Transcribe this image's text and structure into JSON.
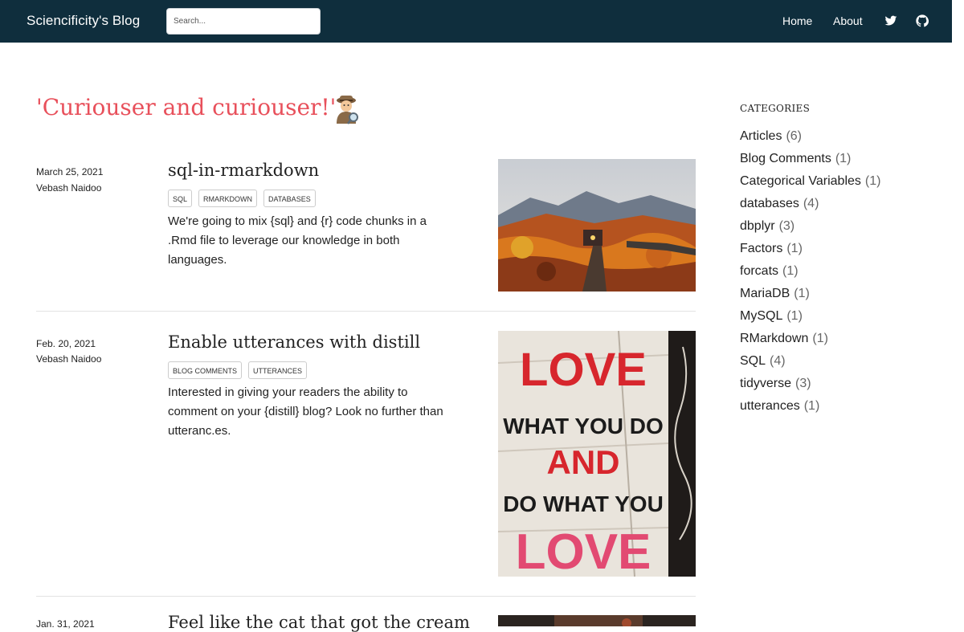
{
  "navbar": {
    "brand": "Sciencificity's Blog",
    "search_placeholder": "Search...",
    "links": [
      "Home",
      "About"
    ],
    "icons": [
      "twitter-icon",
      "github-icon"
    ],
    "background": "#0f2e3d"
  },
  "page": {
    "title": "'Curiouser and curiouser!'",
    "title_icon": "detective-icon",
    "title_color": "#e8505b"
  },
  "posts": [
    {
      "date": "March 25, 2021",
      "author": "Vebash Naidoo",
      "title": "sql-in-rmarkdown",
      "tags": [
        "SQL",
        "RMARKDOWN",
        "DATABASES"
      ],
      "description": "We're going to mix {sql} and {r} code chunks in a .Rmd file to leverage our knowledge in both languages.",
      "image": "autumn-train-image"
    },
    {
      "date": "Feb. 20, 2021",
      "author": "Vebash Naidoo",
      "title": "Enable utterances with distill",
      "tags": [
        "BLOG COMMENTS",
        "UTTERANCES"
      ],
      "description": "Interested in giving your readers the ability to comment on your {distill} blog? Look no further than utteranc.es.",
      "image": "love-sign-image",
      "image_text": [
        "LOVE",
        "WHAT YOU DO",
        "AND",
        "DO WHAT YOU",
        "LOVE"
      ]
    },
    {
      "date": "Jan. 31, 2021",
      "title": "Feel like the cat that got the cream",
      "image": "third-post-image"
    }
  ],
  "sidebar": {
    "heading": "CATEGORIES",
    "categories": [
      {
        "name": "Articles",
        "count": "(6)"
      },
      {
        "name": "Blog Comments",
        "count": "(1)"
      },
      {
        "name": "Categorical Variables",
        "count": "(1)"
      },
      {
        "name": "databases",
        "count": "(4)"
      },
      {
        "name": "dbplyr",
        "count": "(3)"
      },
      {
        "name": "Factors",
        "count": "(1)"
      },
      {
        "name": "forcats",
        "count": "(1)"
      },
      {
        "name": "MariaDB",
        "count": "(1)"
      },
      {
        "name": "MySQL",
        "count": "(1)"
      },
      {
        "name": "RMarkdown",
        "count": "(1)"
      },
      {
        "name": "SQL",
        "count": "(4)"
      },
      {
        "name": "tidyverse",
        "count": "(3)"
      },
      {
        "name": "utterances",
        "count": "(1)"
      }
    ]
  }
}
